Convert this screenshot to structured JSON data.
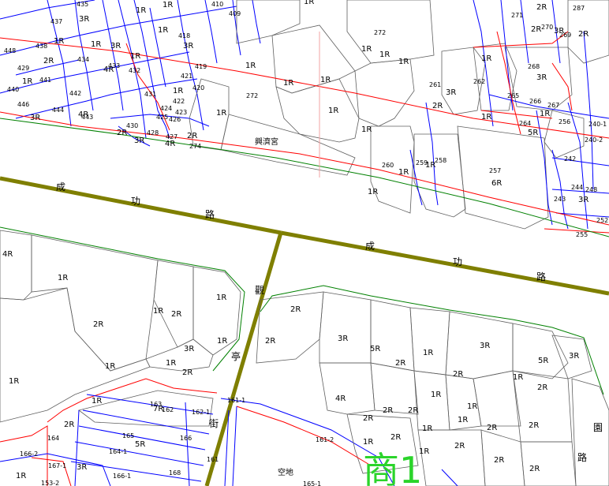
{
  "map": {
    "building_name": "興濟宮",
    "vacant_lot": "空地",
    "roads": [
      {
        "name": "成功路",
        "chars": [
          "成",
          "功",
          "路"
        ]
      },
      {
        "name": "成功路",
        "chars": [
          "成",
          "功",
          "路"
        ]
      },
      {
        "name": "觀亭街",
        "chars": [
          "觀",
          "亭",
          "街"
        ]
      },
      {
        "name": "園路",
        "chars": [
          "園",
          "路"
        ]
      }
    ],
    "overlay_text": "商1",
    "parcel_numbers": [
      "435",
      "410",
      "409",
      "437",
      "438",
      "448",
      "436",
      "434",
      "433",
      "432",
      "429",
      "441",
      "440",
      "446",
      "444",
      "442",
      "443",
      "418",
      "419",
      "421",
      "420",
      "431",
      "424",
      "422",
      "425",
      "423",
      "426",
      "430",
      "428",
      "427",
      "274",
      "272",
      "261",
      "260",
      "259",
      "258",
      "257",
      "255",
      "252",
      "244",
      "243",
      "242",
      "248",
      "240-1",
      "240-2",
      "256",
      "262",
      "264",
      "266",
      "265",
      "267",
      "268",
      "269",
      "270",
      "271",
      "287",
      "163",
      "162",
      "162-1",
      "161-1",
      "161-2",
      "161",
      "165-1",
      "164",
      "165",
      "164-1",
      "166",
      "166-1",
      "166-2",
      "167-1",
      "168",
      "153-2"
    ],
    "floor_labels": [
      "1R",
      "2R",
      "3R",
      "4R",
      "5R",
      "6R",
      "7R"
    ],
    "colors": {
      "road_center": "#7f7f00",
      "parcel_blue": "#0000ff",
      "parcel_red": "#ff0000",
      "parcel_green": "#008000",
      "building_gray": "#606060",
      "overlay_green": "#2bd42b"
    }
  }
}
